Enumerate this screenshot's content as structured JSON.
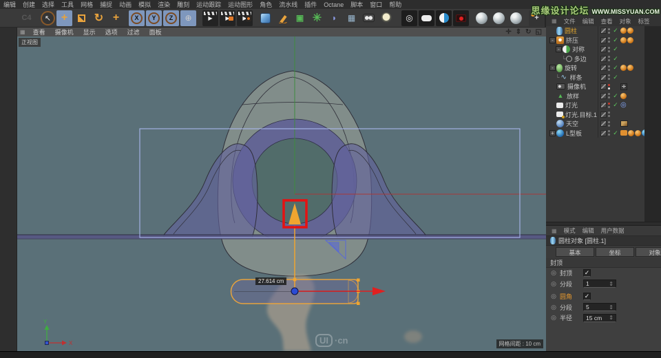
{
  "menubar": {
    "items": [
      "编辑",
      "创建",
      "选择",
      "工具",
      "网格",
      "捕捉",
      "动画",
      "模拟",
      "渲染",
      "雕刻",
      "运动跟踪",
      "运动图形",
      "角色",
      "流水线",
      "插件",
      "Octane",
      "脚本",
      "窗口",
      "帮助"
    ]
  },
  "toolbar": {
    "icons": [
      {
        "name": "c4d-logo",
        "glyph": "C4"
      },
      {
        "name": "select-tool",
        "glyph": "↖"
      },
      {
        "name": "move-tool",
        "glyph": "+"
      },
      {
        "name": "scale-tool",
        "glyph": ""
      },
      {
        "name": "rotate-tool",
        "glyph": "↻"
      },
      {
        "name": "last-used-tool",
        "glyph": "+"
      },
      {
        "name": "lock-x-axis",
        "glyph": "X"
      },
      {
        "name": "lock-y-axis",
        "glyph": "Y"
      },
      {
        "name": "lock-z-axis",
        "glyph": "Z"
      },
      {
        "name": "coordinate-system",
        "glyph": "⊕"
      },
      {
        "name": "render-view",
        "glyph": "▶"
      },
      {
        "name": "render-picture-viewer",
        "glyph": "▶"
      },
      {
        "name": "render-settings",
        "glyph": "▶"
      },
      {
        "name": "primitive-cube",
        "glyph": ""
      },
      {
        "name": "spline-pen",
        "glyph": ""
      },
      {
        "name": "generators",
        "glyph": "▣"
      },
      {
        "name": "deformers",
        "glyph": "✳"
      },
      {
        "name": "fields",
        "glyph": "◗"
      },
      {
        "name": "floor",
        "glyph": "▦"
      },
      {
        "name": "scene-camera",
        "glyph": ""
      },
      {
        "name": "scene-light",
        "glyph": ""
      },
      {
        "name": "material-target",
        "glyph": "◎"
      },
      {
        "name": "material-rounded",
        "glyph": ""
      },
      {
        "name": "material-half",
        "glyph": ""
      },
      {
        "name": "material-camera",
        "glyph": ""
      },
      {
        "name": "material-sphere-1",
        "glyph": ""
      },
      {
        "name": "material-sphere-2",
        "glyph": ""
      },
      {
        "name": "material-sphere-3",
        "glyph": ""
      },
      {
        "name": "axis-handle",
        "glyph": "+"
      },
      {
        "name": "interactive-render-region",
        "glyph": "×"
      },
      {
        "name": "move-down-tool",
        "glyph": "↓"
      }
    ]
  },
  "viewport": {
    "menu": [
      "查看",
      "摄像机",
      "显示",
      "选项",
      "过滤",
      "面板"
    ],
    "controls": [
      {
        "name": "pan",
        "glyph": "✛"
      },
      {
        "name": "zoom",
        "glyph": "⇕"
      },
      {
        "name": "rotate",
        "glyph": "↻"
      },
      {
        "name": "toggle-view",
        "glyph": "◱"
      }
    ],
    "grid_glyph": "▦",
    "view_label": "正视图",
    "measure_label": "27.614 cm",
    "grid_label": "网格间距 : 10 cm",
    "axis_x": "X",
    "axis_y": "Y",
    "logo_text": "UI",
    "logo_suffix": "·cn"
  },
  "watermark": {
    "forum": "思缘设计论坛",
    "url": "WWW.MISSYUAN.COM"
  },
  "object_manager": {
    "menu": [
      "文件",
      "编辑",
      "查看",
      "对象",
      "标签"
    ],
    "grid_glyph": "▦",
    "items": [
      {
        "name": "圆柱",
        "prefix": "",
        "expander": "",
        "check": "✓"
      },
      {
        "name": "挤压",
        "prefix": "",
        "expander": "-",
        "check": "✓"
      },
      {
        "name": "对称",
        "prefix": "",
        "expander": "-",
        "check": "✓"
      },
      {
        "name": "多边",
        "prefix": "└",
        "expander": "",
        "check": "✓"
      },
      {
        "name": "旋转",
        "prefix": "",
        "expander": "-",
        "check": "✓"
      },
      {
        "name": "样条",
        "prefix": "└",
        "expander": "",
        "check": "✓"
      },
      {
        "name": "摄像机",
        "prefix": "",
        "expander": "",
        "check": ""
      },
      {
        "name": "放样",
        "prefix": "",
        "expander": "",
        "check": "✓"
      },
      {
        "name": "灯光",
        "prefix": "",
        "expander": "",
        "check": "✓"
      },
      {
        "name": "灯光.目标.1",
        "prefix": "",
        "expander": "",
        "check": ""
      },
      {
        "name": "天空",
        "prefix": "",
        "expander": "",
        "check": ""
      },
      {
        "name": "L型板",
        "prefix": "",
        "expander": "+",
        "check": "✓"
      }
    ]
  },
  "attribute_manager": {
    "menu": [
      "模式",
      "编辑",
      "用户数据"
    ],
    "grid_glyph": "▦",
    "title": "圆柱对象 [圆柱.1]",
    "tabs": [
      "基本",
      "坐标",
      "对象"
    ],
    "section": "封顶",
    "stepper_glyph": "⇕",
    "rows": [
      {
        "label": "封顶",
        "checked": "✓"
      },
      {
        "label": "分段",
        "value": "1"
      },
      {
        "label": "圆角",
        "checked": "✓"
      },
      {
        "label": "分段",
        "value": "5"
      },
      {
        "label": "半径",
        "value": "15 cm"
      }
    ]
  }
}
